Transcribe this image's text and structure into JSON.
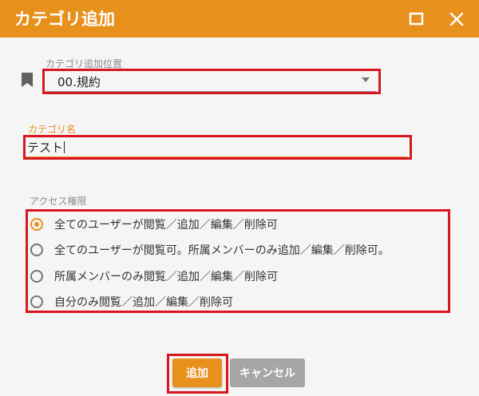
{
  "dialog": {
    "title": "カテゴリ追加",
    "accent_color": "#e8901c",
    "highlight_color": "#d8161f",
    "icons": [
      "maximize-icon",
      "close-icon",
      "bookmark-icon",
      "dropdown-caret-icon"
    ]
  },
  "position_field": {
    "label": "カテゴリ追加位置",
    "value": "00.規約"
  },
  "name_field": {
    "label": "カテゴリ名",
    "value": "テスト"
  },
  "access": {
    "label": "アクセス権限",
    "options": [
      "全てのユーザーが閲覧／追加／編集／削除可",
      "全てのユーザーが閲覧可。所属メンバーのみ追加／編集／削除可。",
      "所属メンバーのみ閲覧／追加／編集／削除可",
      "自分のみ閲覧／追加／編集／削除可"
    ],
    "selected_index": 0
  },
  "buttons": {
    "add": "追加",
    "cancel": "キャンセル"
  }
}
